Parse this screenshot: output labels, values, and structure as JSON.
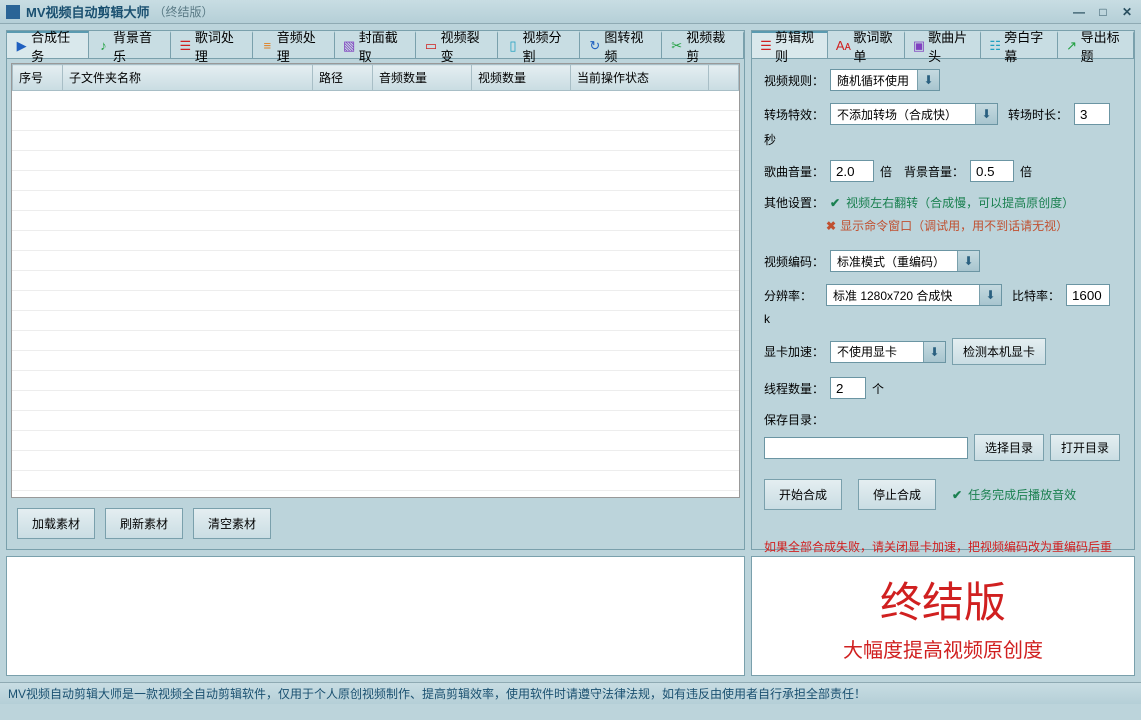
{
  "titlebar": {
    "title": "MV视频自动剪辑大师",
    "suffix": "（终结版）"
  },
  "leftTabs": [
    {
      "icon": "play",
      "iconClass": "ic-blue",
      "label": "合成任务"
    },
    {
      "icon": "music",
      "iconClass": "ic-green",
      "label": "背景音乐"
    },
    {
      "icon": "lyrics",
      "iconClass": "ic-red",
      "label": "歌词处理"
    },
    {
      "icon": "audio",
      "iconClass": "ic-orange",
      "label": "音频处理"
    },
    {
      "icon": "image",
      "iconClass": "ic-purple",
      "label": "封面截取"
    },
    {
      "icon": "split",
      "iconClass": "ic-red",
      "label": "视频裂变"
    },
    {
      "icon": "divide",
      "iconClass": "ic-cyan",
      "label": "视频分割"
    },
    {
      "icon": "convert",
      "iconClass": "ic-blue",
      "label": "图转视频"
    },
    {
      "icon": "crop",
      "iconClass": "ic-green",
      "label": "视频裁剪"
    }
  ],
  "table": {
    "headers": [
      "序号",
      "子文件夹名称",
      "路径",
      "音频数量",
      "视频数量",
      "当前操作状态"
    ]
  },
  "leftButtons": {
    "load": "加载素材",
    "refresh": "刷新素材",
    "clear": "清空素材"
  },
  "rightTabs": [
    {
      "icon": "rules",
      "iconClass": "ic-red",
      "label": "剪辑规则"
    },
    {
      "icon": "list",
      "iconClass": "ic-red",
      "label": "歌词歌单"
    },
    {
      "icon": "clip",
      "iconClass": "ic-purple",
      "label": "歌曲片头"
    },
    {
      "icon": "subtitle",
      "iconClass": "ic-cyan",
      "label": "旁白字幕"
    },
    {
      "icon": "export",
      "iconClass": "ic-green",
      "label": "导出标题"
    }
  ],
  "settings": {
    "videoRule": {
      "label": "视频规则：",
      "value": "随机循环使用"
    },
    "transition": {
      "label": "转场特效：",
      "value": "不添加转场（合成快）"
    },
    "transitionDuration": {
      "label": "转场时长：",
      "value": "3",
      "unit": "秒"
    },
    "songVolume": {
      "label": "歌曲音量：",
      "value": "2.0",
      "unit": "倍"
    },
    "bgVolume": {
      "label": "背景音量：",
      "value": "0.5",
      "unit": "倍"
    },
    "otherLabel": "其他设置：",
    "flipCheck": {
      "label": "视频左右翻转（合成慢，可以提高原创度）",
      "checked": true
    },
    "cmdCheck": {
      "label": "显示命令窗口（调试用，用不到话请无视）",
      "checked": false
    },
    "encoding": {
      "label": "视频编码：",
      "value": "标准模式（重编码）"
    },
    "resolution": {
      "label": "分辨率：",
      "value": "标准 1280x720  合成快"
    },
    "bitrate": {
      "label": "比特率：",
      "value": "1600",
      "unit": "k"
    },
    "gpuAccel": {
      "label": "显卡加速：",
      "value": "不使用显卡"
    },
    "detectGpu": "检测本机显卡",
    "threads": {
      "label": "线程数量：",
      "value": "2",
      "unit": "个"
    },
    "saveDir": {
      "label": "保存目录：",
      "value": ""
    },
    "selectDir": "选择目录",
    "openDir": "打开目录",
    "startBtn": "开始合成",
    "stopBtn": "停止合成",
    "playSound": {
      "label": "任务完成后播放音效"
    },
    "errorMsg": "如果全部合成失败，请关闭显卡加速，把视频编码改为重编码后重试"
  },
  "bottomRight": {
    "title": "终结版",
    "subtitle": "大幅度提高视频原创度"
  },
  "statusbar": "MV视频自动剪辑大师是一款视频全自动剪辑软件，仅用于个人原创视频制作、提高剪辑效率，使用软件时请遵守法律法规，如有违反由使用者自行承担全部责任！"
}
